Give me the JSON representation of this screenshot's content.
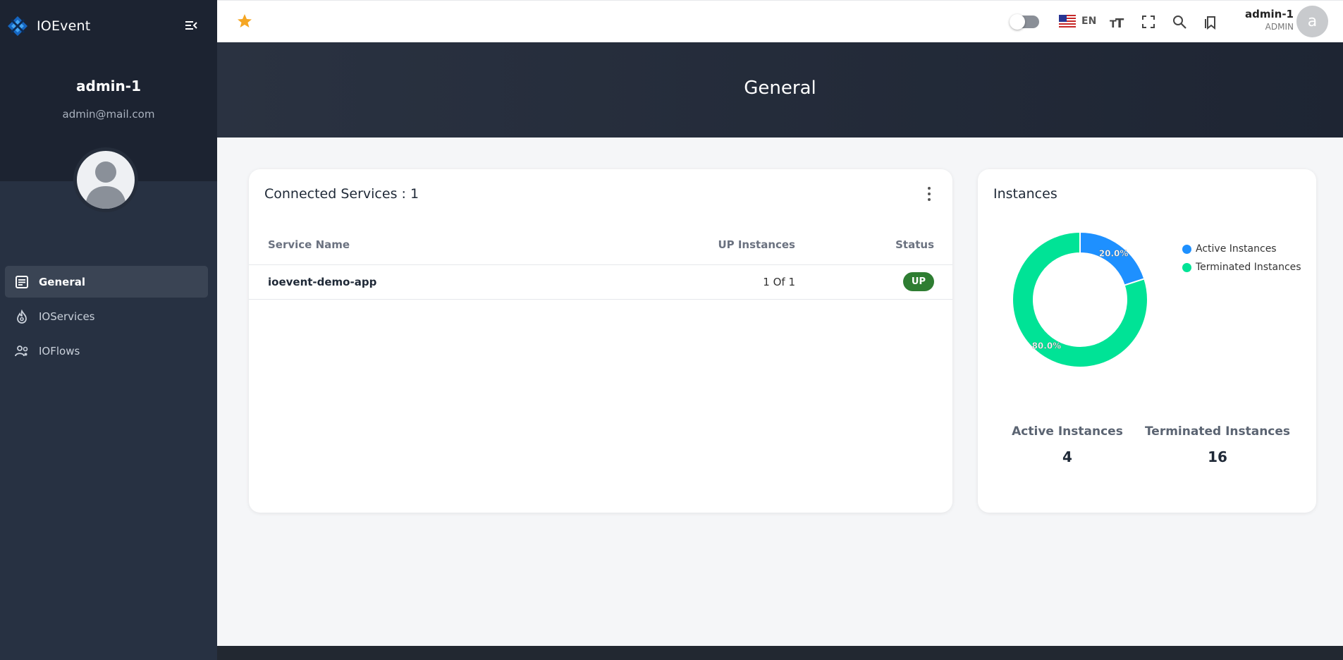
{
  "app": {
    "name": "IOEvent",
    "accent": "#1e88e5"
  },
  "profile": {
    "name": "admin-1",
    "email": "admin@mail.com"
  },
  "sidebar": {
    "items": [
      {
        "label": "General",
        "icon": "document-icon",
        "active": true
      },
      {
        "label": "IOServices",
        "icon": "fire-icon",
        "active": false
      },
      {
        "label": "IOFlows",
        "icon": "users-gear-icon",
        "active": false
      }
    ]
  },
  "header": {
    "language": "EN",
    "user": {
      "name": "admin-1",
      "role": "ADMIN",
      "initial": "a"
    }
  },
  "page": {
    "title": "General"
  },
  "services": {
    "title": "Connected Services : 1",
    "columns": [
      "Service Name",
      "UP Instances",
      "Status"
    ],
    "rows": [
      {
        "name": "ioevent-demo-app",
        "instances": "1 Of 1",
        "status": "UP"
      }
    ]
  },
  "instances": {
    "title": "Instances",
    "active_label": "Active Instances",
    "active_value": "4",
    "terminated_label": "Terminated Instances",
    "terminated_value": "16"
  },
  "chart_data": {
    "type": "pie",
    "categories": [
      "Active Instances",
      "Terminated Instances"
    ],
    "values": [
      20.0,
      80.0
    ],
    "labels": [
      "20.0%",
      "80.0%"
    ],
    "colors": [
      "#1e90ff",
      "#00e396"
    ],
    "legend": "top-right",
    "title": ""
  }
}
